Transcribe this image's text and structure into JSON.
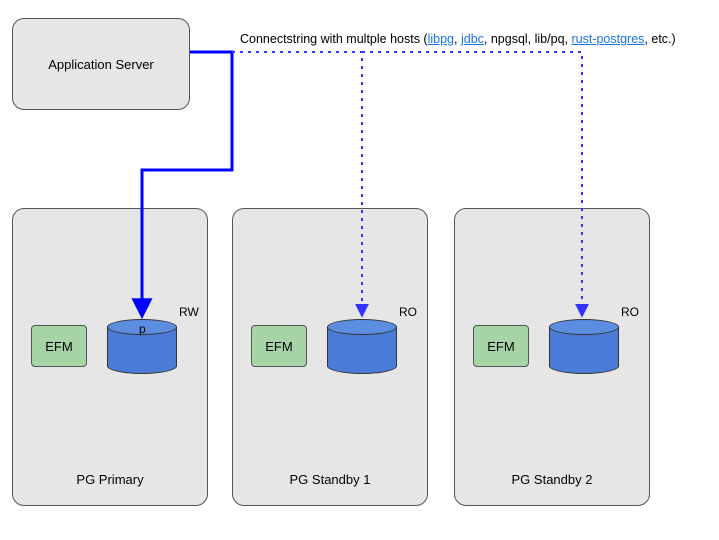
{
  "appserver": {
    "label": "Application Server"
  },
  "connstring": {
    "prefix": "Connectstring with multple hosts (",
    "links": [
      {
        "text": "libpg",
        "is_link": true
      },
      {
        "sep": ", "
      },
      {
        "text": "jdbc",
        "is_link": true
      },
      {
        "sep": ", npgsql, lib/pq, "
      },
      {
        "text": "rust-postgres",
        "is_link": true
      },
      {
        "sep": ", etc.)"
      }
    ]
  },
  "nodes": {
    "primary": {
      "title": "PG Primary",
      "efm": "EFM",
      "db_mode": "RW",
      "db_letter": "p"
    },
    "standby1": {
      "title": "PG Standby 1",
      "efm": "EFM",
      "db_mode": "RO"
    },
    "standby2": {
      "title": "PG Standby 2",
      "efm": "EFM",
      "db_mode": "RO"
    }
  },
  "colors": {
    "solid_line": "#0000ff",
    "dotted_line": "#3333ff"
  }
}
